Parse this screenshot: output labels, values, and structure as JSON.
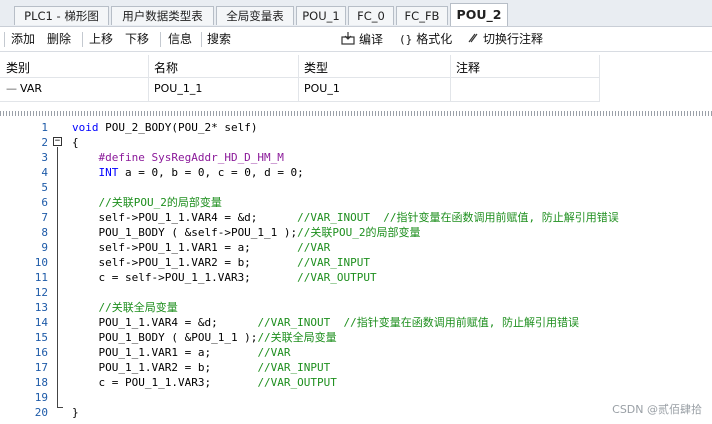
{
  "tabs": [
    {
      "label": "PLC1 - 梯形图",
      "active": false
    },
    {
      "label": "用户数据类型表",
      "active": false
    },
    {
      "label": "全局变量表",
      "active": false
    },
    {
      "label": "POU_1",
      "active": false
    },
    {
      "label": "FC_0",
      "active": false
    },
    {
      "label": "FC_FB",
      "active": false
    },
    {
      "label": "POU_2",
      "active": true
    }
  ],
  "toolbar": {
    "add": "添加",
    "delete": "删除",
    "move_up": "上移",
    "move_down": "下移",
    "info": "信息",
    "search": "搜索",
    "compile": "编译",
    "format": "格式化",
    "toggle_comment": "切换行注释",
    "compile_icon": "compile-icon",
    "format_icon": "braces-icon",
    "comment_icon": "comment-toggle-icon"
  },
  "var_table": {
    "headers": {
      "category": "类别",
      "name": "名称",
      "type": "类型",
      "comment": "注释"
    },
    "rows": [
      {
        "category": "VAR",
        "name": "POU_1_1",
        "type": "POU_1",
        "comment": ""
      }
    ]
  },
  "code_lines": [
    [
      {
        "t": "kw",
        "v": "void"
      },
      {
        "t": "p",
        "v": " POU_2_BODY(POU_2* self)"
      }
    ],
    [
      {
        "t": "p",
        "v": "{"
      }
    ],
    [
      {
        "t": "pp",
        "v": "    #define SysRegAddr_HD_D_HM_M"
      }
    ],
    [
      {
        "t": "p",
        "v": "    "
      },
      {
        "t": "kw",
        "v": "INT"
      },
      {
        "t": "p",
        "v": " a = 0, b = 0, c = 0, d = 0;"
      }
    ],
    [],
    [
      {
        "t": "cm",
        "v": "    //关联POU_2的局部变量"
      }
    ],
    [
      {
        "t": "p",
        "v": "    self->POU_1_1.VAR4 = &d;      "
      },
      {
        "t": "cm",
        "v": "//VAR_INOUT  //指针变量在函数调用前赋值, 防止解引用错误"
      }
    ],
    [
      {
        "t": "p",
        "v": "    POU_1_BODY ( &self->POU_1_1 );"
      },
      {
        "t": "cm",
        "v": "//关联POU_2的局部变量"
      }
    ],
    [
      {
        "t": "p",
        "v": "    self->POU_1_1.VAR1 = a;       "
      },
      {
        "t": "cm",
        "v": "//VAR"
      }
    ],
    [
      {
        "t": "p",
        "v": "    self->POU_1_1.VAR2 = b;       "
      },
      {
        "t": "cm",
        "v": "//VAR_INPUT"
      }
    ],
    [
      {
        "t": "p",
        "v": "    c = self->POU_1_1.VAR3;       "
      },
      {
        "t": "cm",
        "v": "//VAR_OUTPUT"
      }
    ],
    [],
    [
      {
        "t": "cm",
        "v": "    //关联全局变量"
      }
    ],
    [
      {
        "t": "p",
        "v": "    POU_1_1.VAR4 = &d;      "
      },
      {
        "t": "cm",
        "v": "//VAR_INOUT  //指针变量在函数调用前赋值, 防止解引用错误"
      }
    ],
    [
      {
        "t": "p",
        "v": "    POU_1_BODY ( &POU_1_1 );"
      },
      {
        "t": "cm",
        "v": "//关联全局变量"
      }
    ],
    [
      {
        "t": "p",
        "v": "    POU_1_1.VAR1 = a;       "
      },
      {
        "t": "cm",
        "v": "//VAR"
      }
    ],
    [
      {
        "t": "p",
        "v": "    POU_1_1.VAR2 = b;       "
      },
      {
        "t": "cm",
        "v": "//VAR_INPUT"
      }
    ],
    [
      {
        "t": "p",
        "v": "    c = POU_1_1.VAR3;       "
      },
      {
        "t": "cm",
        "v": "//VAR_OUTPUT"
      }
    ],
    [],
    [
      {
        "t": "p",
        "v": "}"
      }
    ]
  ],
  "line_numbers": [
    "1",
    "2",
    "3",
    "4",
    "5",
    "6",
    "7",
    "8",
    "9",
    "10",
    "11",
    "12",
    "13",
    "14",
    "15",
    "16",
    "17",
    "18",
    "19",
    "20"
  ],
  "fold_marker": "−",
  "watermark": "CSDN @贰佰肆拾"
}
